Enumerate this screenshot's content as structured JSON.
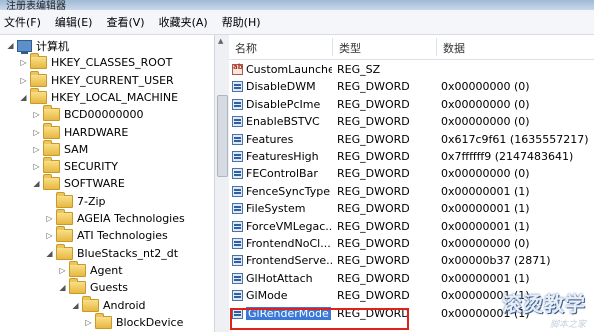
{
  "window": {
    "title": "注册表编辑器"
  },
  "menu": [
    "文件(F)",
    "编辑(E)",
    "查看(V)",
    "收藏夹(A)",
    "帮助(H)"
  ],
  "tree": [
    {
      "label": "计算机",
      "icon": "computer-icon",
      "expander": "◢"
    },
    {
      "label": "HKEY_CLASSES_ROOT",
      "icon": "folder-icon",
      "expander": "▷"
    },
    {
      "label": "HKEY_CURRENT_USER",
      "icon": "folder-icon",
      "expander": "▷"
    },
    {
      "label": "HKEY_LOCAL_MACHINE",
      "icon": "folder-icon",
      "expander": "◢"
    },
    {
      "label": "BCD00000000",
      "icon": "folder-icon",
      "expander": "▷"
    },
    {
      "label": "HARDWARE",
      "icon": "folder-icon",
      "expander": "▷"
    },
    {
      "label": "SAM",
      "icon": "folder-icon",
      "expander": "▷"
    },
    {
      "label": "SECURITY",
      "icon": "folder-icon",
      "expander": "▷"
    },
    {
      "label": "SOFTWARE",
      "icon": "folder-icon",
      "expander": "◢"
    },
    {
      "label": "7-Zip",
      "icon": "folder-icon",
      "expander": ""
    },
    {
      "label": "AGEIA Technologies",
      "icon": "folder-icon",
      "expander": "▷"
    },
    {
      "label": "ATI Technologies",
      "icon": "folder-icon",
      "expander": "▷"
    },
    {
      "label": "BlueStacks_nt2_dt",
      "icon": "folder-icon",
      "expander": "◢"
    },
    {
      "label": "Agent",
      "icon": "folder-icon",
      "expander": "▷"
    },
    {
      "label": "Guests",
      "icon": "folder-icon",
      "expander": "◢"
    },
    {
      "label": "Android",
      "icon": "folder-icon",
      "expander": "◢"
    },
    {
      "label": "BlockDevice",
      "icon": "folder-icon",
      "expander": "▷"
    }
  ],
  "list": {
    "headers": {
      "name": "名称",
      "type": "类型",
      "data": "数据"
    },
    "rows": [
      {
        "name": "CustomLauncher",
        "type": "REG_SZ",
        "data": "",
        "icon": "string-value-icon"
      },
      {
        "name": "DisableDWM",
        "type": "REG_DWORD",
        "data": "0x00000000 (0)",
        "icon": "dword-value-icon"
      },
      {
        "name": "DisablePcIme",
        "type": "REG_DWORD",
        "data": "0x00000000 (0)",
        "icon": "dword-value-icon"
      },
      {
        "name": "EnableBSTVC",
        "type": "REG_DWORD",
        "data": "0x00000000 (0)",
        "icon": "dword-value-icon"
      },
      {
        "name": "Features",
        "type": "REG_DWORD",
        "data": "0x617c9f61 (1635557217)",
        "icon": "dword-value-icon"
      },
      {
        "name": "FeaturesHigh",
        "type": "REG_DWORD",
        "data": "0x7ffffff9 (2147483641)",
        "icon": "dword-value-icon"
      },
      {
        "name": "FEControlBar",
        "type": "REG_DWORD",
        "data": "0x00000000 (0)",
        "icon": "dword-value-icon"
      },
      {
        "name": "FenceSyncType",
        "type": "REG_DWORD",
        "data": "0x00000001 (1)",
        "icon": "dword-value-icon"
      },
      {
        "name": "FileSystem",
        "type": "REG_DWORD",
        "data": "0x00000001 (1)",
        "icon": "dword-value-icon"
      },
      {
        "name": "ForceVMLegac...",
        "type": "REG_DWORD",
        "data": "0x00000001 (1)",
        "icon": "dword-value-icon"
      },
      {
        "name": "FrontendNoCl...",
        "type": "REG_DWORD",
        "data": "0x00000000 (0)",
        "icon": "dword-value-icon"
      },
      {
        "name": "FrontendServe...",
        "type": "REG_DWORD",
        "data": "0x00000b37 (2871)",
        "icon": "dword-value-icon"
      },
      {
        "name": "GlHotAttach",
        "type": "REG_DWORD",
        "data": "0x00000001 (1)",
        "icon": "dword-value-icon"
      },
      {
        "name": "GlMode",
        "type": "REG_DWORD",
        "data": "0x00000001 (1)",
        "icon": "dword-value-icon"
      },
      {
        "name": "GlRenderMode",
        "type": "REG_DWORD",
        "data": "0x00000001 (1)",
        "icon": "dword-value-icon",
        "selected": true
      }
    ]
  },
  "watermark": {
    "main": "滚烫教学",
    "sub": "脚本之家"
  },
  "colors": {
    "selection": "#3a78d8",
    "highlight_border": "#e0201a"
  }
}
